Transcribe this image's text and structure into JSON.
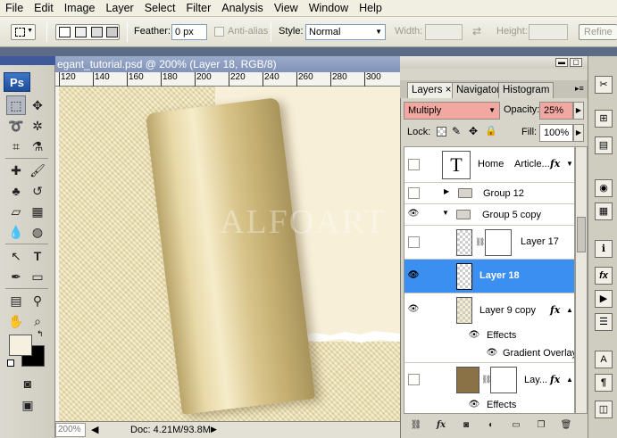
{
  "menubar": {
    "items": [
      "File",
      "Edit",
      "Image",
      "Layer",
      "Select",
      "Filter",
      "Analysis",
      "View",
      "Window",
      "Help"
    ]
  },
  "options": {
    "feather_label": "Feather:",
    "feather_value": "0 px",
    "antialias_label": "Anti-alias",
    "style_label": "Style:",
    "style_value": "Normal",
    "width_label": "Width:",
    "height_label": "Height:",
    "refine_label": "Refine"
  },
  "toolbar": {
    "logo": "Ps",
    "tools": [
      "marquee-icon",
      "move-icon",
      "lasso-icon",
      "magic-wand-icon",
      "crop-icon",
      "eyedropper-icon",
      "healing-icon",
      "brush-icon",
      "stamp-icon",
      "history-brush-icon",
      "eraser-icon",
      "gradient-icon",
      "blur-icon",
      "dodge-icon",
      "path-select-icon",
      "type-icon",
      "pen-icon",
      "shape-icon",
      "notes-icon",
      "eyedropper2-icon",
      "hand-icon",
      "zoom-icon"
    ],
    "foreground_color": "#f5f0e0",
    "background_color": "#000000"
  },
  "document": {
    "title": "egant_tutorial.psd @ 200% (Layer 18, RGB/8)",
    "ruler_ticks": [
      "120",
      "140",
      "160",
      "180",
      "200",
      "220",
      "240",
      "260",
      "280",
      "300"
    ],
    "watermark": "ALFOART",
    "zoom": "200%",
    "doc_info": "Doc: 4.21M/93.8M"
  },
  "layers_panel": {
    "tabs": [
      "Layers",
      "Navigator",
      "Histogram"
    ],
    "tab_close": "×",
    "blend_mode": "Multiply",
    "opacity_label": "Opacity:",
    "opacity_value": "25%",
    "lock_label": "Lock:",
    "fill_label": "Fill:",
    "fill_value": "100%",
    "layers": [
      {
        "name": "Home",
        "extra": "Article...",
        "type": "text",
        "fx": "fx"
      },
      {
        "name": "Group 12",
        "type": "group"
      },
      {
        "name": "Group 5 copy",
        "type": "group"
      },
      {
        "name": "Layer 17",
        "type": "layer"
      },
      {
        "name": "Layer 18",
        "type": "layer",
        "selected": true
      },
      {
        "name": "Layer 9 copy",
        "type": "layer",
        "fx": "fx"
      },
      {
        "name": "Effects",
        "type": "effects"
      },
      {
        "name": "Gradient Overlay",
        "type": "effect"
      },
      {
        "name": "Lay...",
        "type": "layer",
        "fx": "fx"
      },
      {
        "name": "Effects",
        "type": "effects"
      }
    ],
    "text_thumb": "T"
  },
  "accent": {
    "selection": "#3b8ff0",
    "blend_highlight": "#f2a8a0"
  }
}
